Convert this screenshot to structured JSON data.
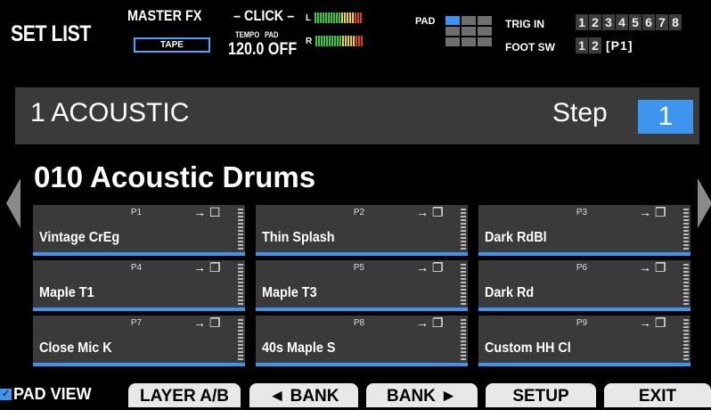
{
  "header": {
    "title": "SET LIST",
    "master_fx_label": "MASTER FX",
    "master_fx_value": "TAPE",
    "click_label": "– CLICK –",
    "tempo_label": "TEMPO",
    "pad_label": "PAD",
    "tempo_value": "120.0",
    "pad_value": "OFF",
    "meter_left": "L",
    "meter_right": "R",
    "pad_word": "PAD",
    "trig_in_label": "TRIG IN",
    "trig_in_numbers": [
      "1",
      "2",
      "3",
      "4",
      "5",
      "6",
      "7",
      "8"
    ],
    "foot_sw_label": "FOOT SW",
    "foot_sw_numbers": [
      "1",
      "2"
    ],
    "foot_sw_value": "[P1]"
  },
  "set": {
    "name": "1 ACOUSTIC",
    "step_label": "Step",
    "step_value": "1"
  },
  "kit": {
    "name": "010 Acoustic Drums"
  },
  "pads": [
    {
      "id": "P1",
      "instrument": "Vintage CrEg",
      "icon": "→ ☐"
    },
    {
      "id": "P2",
      "instrument": "Thin Splash",
      "icon": "→ ❐"
    },
    {
      "id": "P3",
      "instrument": "Dark RdBl",
      "icon": "→ ❐"
    },
    {
      "id": "P4",
      "instrument": "Maple T1",
      "icon": "→ ❐"
    },
    {
      "id": "P5",
      "instrument": "Maple T3",
      "icon": "→ ❐"
    },
    {
      "id": "P6",
      "instrument": "Dark Rd",
      "icon": "→ ❐"
    },
    {
      "id": "P7",
      "instrument": "Close Mic K",
      "icon": "→ ❐"
    },
    {
      "id": "P8",
      "instrument": "40s Maple S",
      "icon": "→ ❐"
    },
    {
      "id": "P9",
      "instrument": "Custom HH Cl",
      "icon": "→ ❐"
    }
  ],
  "footer": {
    "pad_view_label": "PAD VIEW",
    "pad_view_checked": "✓",
    "layer_label": "LAYER A/B",
    "bank_prev_label": "◄ BANK",
    "bank_next_label": "BANK ►",
    "setup_label": "SETUP",
    "exit_label": "EXIT"
  },
  "colors": {
    "accent": "#3d95f0",
    "panel": "#3a3a3a",
    "button": "#e8e8e8"
  }
}
